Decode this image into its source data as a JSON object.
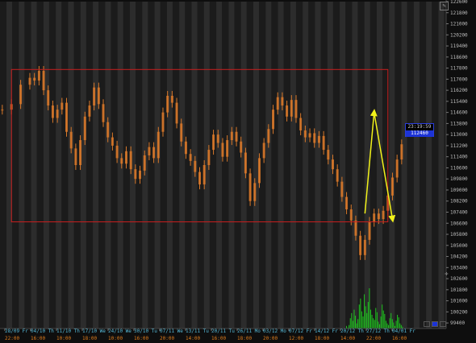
{
  "chart_data": {
    "type": "candlestick",
    "title": "",
    "xlabel": "",
    "ylabel": "",
    "ylim": [
      99000,
      122600
    ],
    "grid": false,
    "y_ticks": [
      99400,
      100200,
      101000,
      101800,
      102600,
      103400,
      104200,
      105000,
      105800,
      106600,
      107400,
      108200,
      109000,
      109800,
      110600,
      111400,
      112200,
      113000,
      113800,
      114600,
      115400,
      116200,
      117000,
      117800,
      118600,
      119400,
      120200,
      121000,
      121800,
      122600
    ],
    "x_ticks": [
      {
        "date": "28/09 Fr",
        "time": "22:00"
      },
      {
        "date": "04/10 Th",
        "time": "16:00"
      },
      {
        "date": "11/10 Th",
        "time": "10:00"
      },
      {
        "date": "17/10 We",
        "time": "18:00"
      },
      {
        "date": "24/10 We",
        "time": "10:00"
      },
      {
        "date": "30/10 Tu",
        "time": "16:00"
      },
      {
        "date": "07/11 We",
        "time": "20:00"
      },
      {
        "date": "13/11 Tu",
        "time": "14:00"
      },
      {
        "date": "20/11 Tu",
        "time": "16:00"
      },
      {
        "date": "26/11 Mo",
        "time": "18:00"
      },
      {
        "date": "03/12 Mo",
        "time": "20:00"
      },
      {
        "date": "07/12 Fr",
        "time": "12:00"
      },
      {
        "date": "14/12 Fr",
        "time": "18:00"
      },
      {
        "date": "20/12 Th",
        "time": "14:00"
      },
      {
        "date": "27/12 Th",
        "time": "22:00"
      },
      {
        "date": "04/01 Fr",
        "time": "16:00"
      }
    ],
    "last_time": "23:19:59",
    "last_price": "112460",
    "price_series": [
      {
        "t": 0,
        "v": 114800
      },
      {
        "t": 2,
        "v": 115200
      },
      {
        "t": 4,
        "v": 116600
      },
      {
        "t": 6,
        "v": 117100
      },
      {
        "t": 7,
        "v": 116900
      },
      {
        "t": 8,
        "v": 117600
      },
      {
        "t": 9,
        "v": 116200
      },
      {
        "t": 10,
        "v": 115100
      },
      {
        "t": 11,
        "v": 114200
      },
      {
        "t": 12,
        "v": 114800
      },
      {
        "t": 13,
        "v": 115300
      },
      {
        "t": 14,
        "v": 113200
      },
      {
        "t": 15,
        "v": 112000
      },
      {
        "t": 16,
        "v": 110800
      },
      {
        "t": 17,
        "v": 112600
      },
      {
        "t": 18,
        "v": 114300
      },
      {
        "t": 19,
        "v": 115100
      },
      {
        "t": 20,
        "v": 116400
      },
      {
        "t": 21,
        "v": 115200
      },
      {
        "t": 22,
        "v": 113900
      },
      {
        "t": 23,
        "v": 112800
      },
      {
        "t": 24,
        "v": 112200
      },
      {
        "t": 25,
        "v": 111300
      },
      {
        "t": 26,
        "v": 110900
      },
      {
        "t": 27,
        "v": 111800
      },
      {
        "t": 28,
        "v": 110500
      },
      {
        "t": 29,
        "v": 109800
      },
      {
        "t": 30,
        "v": 110400
      },
      {
        "t": 31,
        "v": 111500
      },
      {
        "t": 32,
        "v": 112100
      },
      {
        "t": 33,
        "v": 111300
      },
      {
        "t": 34,
        "v": 113200
      },
      {
        "t": 35,
        "v": 114600
      },
      {
        "t": 36,
        "v": 115800
      },
      {
        "t": 37,
        "v": 115300
      },
      {
        "t": 38,
        "v": 113800
      },
      {
        "t": 39,
        "v": 112500
      },
      {
        "t": 40,
        "v": 111600
      },
      {
        "t": 41,
        "v": 111100
      },
      {
        "t": 42,
        "v": 110300
      },
      {
        "t": 43,
        "v": 109400
      },
      {
        "t": 44,
        "v": 110800
      },
      {
        "t": 45,
        "v": 111900
      },
      {
        "t": 46,
        "v": 113000
      },
      {
        "t": 47,
        "v": 112400
      },
      {
        "t": 48,
        "v": 111400
      },
      {
        "t": 49,
        "v": 112600
      },
      {
        "t": 50,
        "v": 113200
      },
      {
        "t": 51,
        "v": 112500
      },
      {
        "t": 52,
        "v": 111700
      },
      {
        "t": 53,
        "v": 110200
      },
      {
        "t": 54,
        "v": 108200
      },
      {
        "t": 55,
        "v": 109500
      },
      {
        "t": 56,
        "v": 111300
      },
      {
        "t": 57,
        "v": 112400
      },
      {
        "t": 58,
        "v": 113400
      },
      {
        "t": 59,
        "v": 114800
      },
      {
        "t": 60,
        "v": 115700
      },
      {
        "t": 61,
        "v": 115100
      },
      {
        "t": 62,
        "v": 114300
      },
      {
        "t": 63,
        "v": 115500
      },
      {
        "t": 64,
        "v": 114200
      },
      {
        "t": 65,
        "v": 113300
      },
      {
        "t": 66,
        "v": 112800
      },
      {
        "t": 67,
        "v": 113100
      },
      {
        "t": 68,
        "v": 112400
      },
      {
        "t": 69,
        "v": 112900
      },
      {
        "t": 70,
        "v": 111900
      },
      {
        "t": 71,
        "v": 111200
      },
      {
        "t": 72,
        "v": 110500
      },
      {
        "t": 73,
        "v": 109600
      },
      {
        "t": 74,
        "v": 108500
      },
      {
        "t": 75,
        "v": 107600
      },
      {
        "t": 76,
        "v": 106800
      },
      {
        "t": 77,
        "v": 105700
      },
      {
        "t": 78,
        "v": 104300
      },
      {
        "t": 79,
        "v": 105400
      },
      {
        "t": 80,
        "v": 106700
      },
      {
        "t": 81,
        "v": 107300
      },
      {
        "t": 82,
        "v": 106900
      },
      {
        "t": 83,
        "v": 107500
      },
      {
        "t": 84,
        "v": 108600
      },
      {
        "t": 85,
        "v": 109900
      },
      {
        "t": 86,
        "v": 111200
      },
      {
        "t": 87,
        "v": 112300
      }
    ],
    "volume_series": [
      0,
      0,
      0,
      0,
      0,
      0,
      0,
      0,
      0,
      0,
      0,
      0,
      0,
      0,
      0,
      0,
      0,
      0,
      0,
      0,
      0,
      0,
      0,
      0,
      0,
      0,
      0,
      0,
      0,
      0,
      0,
      0,
      0,
      0,
      0,
      0,
      0,
      0,
      0,
      0,
      0,
      0,
      0,
      0,
      0,
      0,
      0,
      0,
      0,
      0,
      0,
      0,
      0,
      0,
      0,
      0,
      0,
      0,
      0,
      0,
      0,
      0,
      0,
      0,
      0,
      0,
      0,
      0,
      0,
      0,
      0,
      0,
      0,
      0,
      0,
      0,
      0,
      0,
      3,
      1,
      4,
      12,
      18,
      9,
      22,
      15,
      6,
      11,
      28,
      35,
      20,
      14,
      40,
      26,
      18,
      31,
      47,
      22,
      16,
      12,
      10,
      24,
      19,
      8,
      5,
      14,
      28,
      21,
      17,
      9,
      6,
      4,
      12,
      18,
      11,
      7,
      3,
      9,
      16,
      13,
      6,
      4,
      2
    ],
    "annotations": {
      "rectangle": {
        "from_t": 2,
        "to_t": 84,
        "low": 106700,
        "high": 117700
      },
      "arrow_up": {
        "from": {
          "t": 79,
          "v": 107300
        },
        "to": {
          "t": 81,
          "v": 114600
        }
      },
      "arrow_down": {
        "from": {
          "t": 81,
          "v": 114600
        },
        "to": {
          "t": 85,
          "v": 106900
        }
      }
    },
    "colors": {
      "background": "#1b1b1b",
      "stripe": "#2c2c2c",
      "candle": "#d8782a",
      "volume": "#1fc21f",
      "rectangle": "#c81e1e",
      "arrows": "#f2f21a",
      "y_labels": "#bdbdbd",
      "x_dates": "#56b8d6",
      "x_times": "#e07d1e"
    }
  }
}
